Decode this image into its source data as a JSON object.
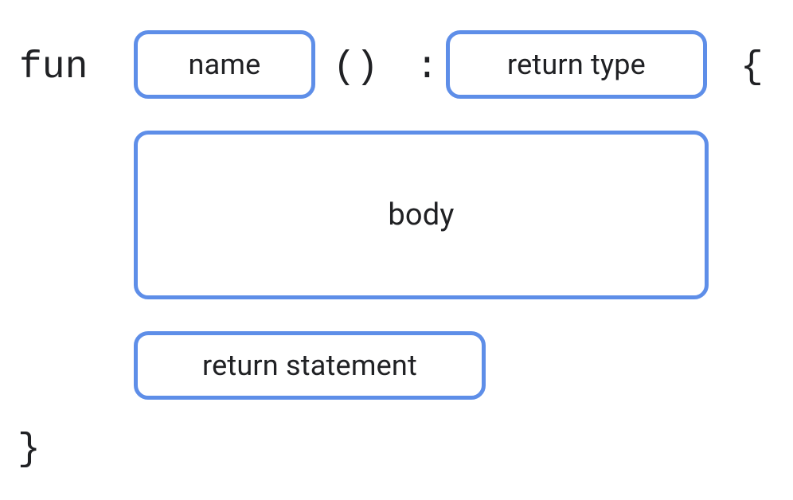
{
  "syntax": {
    "keyword": "fun",
    "parens": "()",
    "colon": ":",
    "brace_open": "{",
    "brace_close": "}"
  },
  "slots": {
    "name": "name",
    "return_type": "return type",
    "body": "body",
    "return_statement": "return statement"
  }
}
